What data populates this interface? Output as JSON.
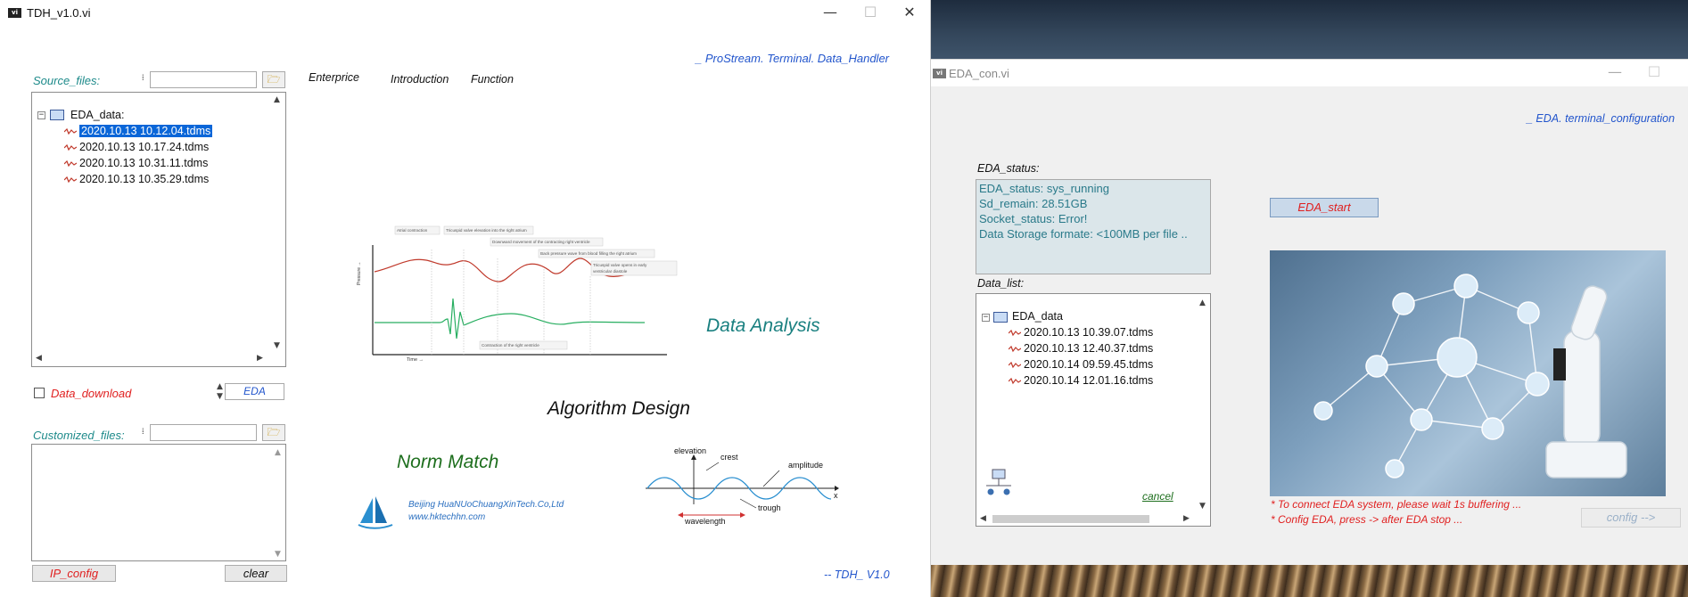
{
  "tdh": {
    "title": "TDH_v1.0.vi",
    "logo": "vi",
    "controls": {
      "minimize": "—",
      "maximize": "☐",
      "close": "✕"
    },
    "header_link": "_ ProStream. Terminal. Data_Handler",
    "source_files_label": "Source_files:",
    "source_tree": {
      "root": "EDA_data:",
      "items": [
        "2020.10.13 10.12.04.tdms",
        "2020.10.13 10.17.24.tdms",
        "2020.10.13 10.31.11.tdms",
        "2020.10.13 10.35.29.tdms"
      ]
    },
    "menu": [
      "Enterprice",
      "Introduction",
      "Function"
    ],
    "data_download_label": "Data_download",
    "eda_field_value": "EDA",
    "customized_files_label": "Customized_files:",
    "ip_config_label": "IP_config",
    "clear_label": "clear",
    "version_label": "-- TDH_ V1.0",
    "data_analysis": "Data Analysis",
    "algorithm_design": "Algorithm Design",
    "norm_match": "Norm Match",
    "company_name": "Beijing HuaNUoChuangXinTech.Co,Ltd",
    "company_url": "www.hktechhn.com",
    "pressure_chart": {
      "ylabel": "Pressure →",
      "xlabel": "Time →",
      "annotations": [
        "Atrial contraction",
        "Tricuspid valve elevation into the right atrium",
        "Downward movement of the contracting right ventricle",
        "Back pressure wave from blood filling the right atrium",
        "Tricuspid valve opens in early",
        "ventricular diastole",
        "Contraction of the right ventricle"
      ]
    },
    "wave_diagram": {
      "elevation": "elevation",
      "crest": "crest",
      "amplitude": "amplitude",
      "trough": "trough",
      "wavelength": "wavelength",
      "x": "x"
    }
  },
  "eda": {
    "title": "EDA_con.vi",
    "logo": "vi",
    "header_link": "_ EDA. terminal_configuration",
    "status_label": "EDA_status:",
    "status_lines": [
      "EDA_status:   sys_running",
      "Sd_remain:   28.51GB",
      "Socket_status:   Error!",
      "Data Storage formate: <100MB per file .."
    ],
    "start_button": "EDA_start",
    "data_list_label": "Data_list:",
    "data_tree": {
      "root": "EDA_data",
      "items": [
        "2020.10.13 10.39.07.tdms",
        "2020.10.13 12.40.37.tdms",
        "2020.10.14 09.59.45.tdms",
        "2020.10.14 12.01.16.tdms"
      ]
    },
    "cancel_label": "cancel",
    "notes": [
      "* To connect  EDA system, please wait 1s buffering ...",
      "* Config EDA, press -> after  EDA stop ..."
    ],
    "config_button": "config -->"
  }
}
